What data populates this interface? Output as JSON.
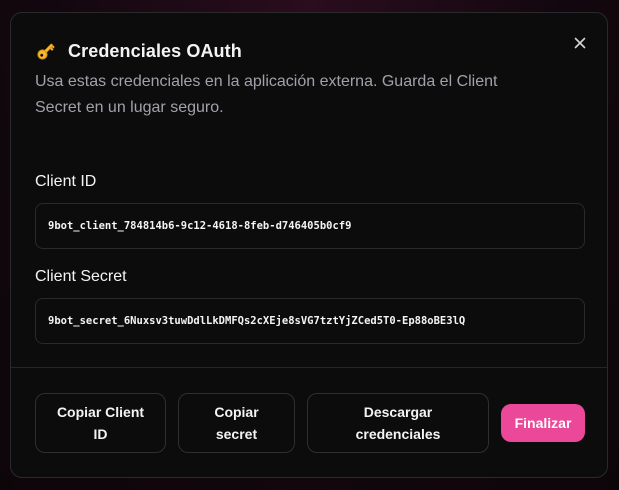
{
  "dialog": {
    "title": "Credenciales OAuth",
    "title_icon": "key-icon",
    "description": "Usa estas credenciales en la aplicación externa. Guarda el Client Secret en un lugar seguro.",
    "close_icon": "close-icon"
  },
  "fields": {
    "client_id": {
      "label": "Client ID",
      "value": "9bot_client_784814b6-9c12-4618-8feb-d746405b0cf9"
    },
    "client_secret": {
      "label": "Client Secret",
      "value": "9bot_secret_6Nuxsv3tuwDdlLkDMFQs2cXEje8sVG7tztYjZCed5T0-Ep88oBE3lQ"
    }
  },
  "footer": {
    "copy_id_label": "Copiar Client ID",
    "copy_secret_label": "Copiar secret",
    "download_label": "Descargar credenciales",
    "finish_label": "Finalizar"
  },
  "colors": {
    "accent": "#ec4899",
    "background": "#0c0c0d",
    "border": "#2a2a2d",
    "text_primary": "#f4f4f5",
    "text_muted": "#a1a1aa"
  }
}
